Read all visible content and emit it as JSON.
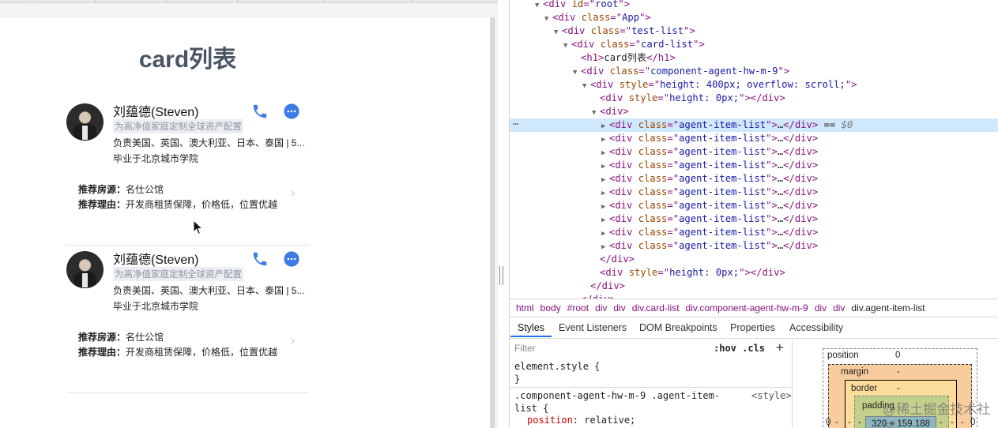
{
  "app": {
    "heading": "card列表",
    "cards": [
      {
        "name": "刘蕴德(Steven)",
        "tag": "为高净值家庭定制全球资产配置",
        "desc": "负责美国、英国、澳大利亚、日本、泰国 | 5...",
        "school": "毕业于北京城市学院",
        "rec_source_label": "推荐房源：",
        "rec_source": "名仕公馆",
        "rec_reason_label": "推荐理由：",
        "rec_reason": "开发商租赁保障，价格低，位置优越"
      },
      {
        "name": "刘蕴德(Steven)",
        "tag": "为高净值家庭定制全球资产配置",
        "desc": "负责美国、英国、澳大利亚、日本、泰国 | 5...",
        "school": "毕业于北京城市学院",
        "rec_source_label": "推荐房源：",
        "rec_source": "名仕公馆",
        "rec_reason_label": "推荐理由：",
        "rec_reason": "开发商租赁保障，价格低，位置优越"
      }
    ],
    "accent_color": "#3d7be6"
  },
  "devtools": {
    "dom_lines": [
      {
        "t": "▼",
        "parts": [
          [
            "tg",
            "<div "
          ],
          [
            "at",
            "id"
          ],
          [
            "tg",
            "=\""
          ],
          [
            "av",
            "root"
          ],
          [
            "tg",
            "\">"
          ]
        ]
      },
      {
        "t": "▼",
        "parts": [
          [
            "tg",
            "<div "
          ],
          [
            "at",
            "class"
          ],
          [
            "tg",
            "=\""
          ],
          [
            "av",
            "App"
          ],
          [
            "tg",
            "\">"
          ]
        ]
      },
      {
        "t": "▼",
        "parts": [
          [
            "tg",
            "<div "
          ],
          [
            "at",
            "class"
          ],
          [
            "tg",
            "=\""
          ],
          [
            "av",
            "test-list"
          ],
          [
            "tg",
            "\">"
          ]
        ]
      },
      {
        "t": "▼",
        "parts": [
          [
            "tg",
            "<div "
          ],
          [
            "at",
            "class"
          ],
          [
            "tg",
            "=\""
          ],
          [
            "av",
            "card-list"
          ],
          [
            "tg",
            "\">"
          ]
        ]
      },
      {
        "t": "",
        "parts": [
          [
            "tg",
            "<h1>"
          ],
          [
            "tx",
            "card列表"
          ],
          [
            "tg",
            "</h1>"
          ]
        ]
      },
      {
        "t": "▼",
        "parts": [
          [
            "tg",
            "<div "
          ],
          [
            "at",
            "class"
          ],
          [
            "tg",
            "=\""
          ],
          [
            "av",
            "component-agent-hw-m-9"
          ],
          [
            "tg",
            "\">"
          ]
        ]
      },
      {
        "t": "▼",
        "parts": [
          [
            "tg",
            "<div "
          ],
          [
            "at",
            "style"
          ],
          [
            "tg",
            "=\""
          ],
          [
            "av",
            "height: 400px; overflow: scroll;"
          ],
          [
            "tg",
            "\">"
          ]
        ]
      },
      {
        "t": "",
        "parts": [
          [
            "tg",
            "<div "
          ],
          [
            "at",
            "style"
          ],
          [
            "tg",
            "=\""
          ],
          [
            "av",
            "height: 0px;"
          ],
          [
            "tg",
            "\"></div>"
          ]
        ]
      },
      {
        "t": "▼",
        "parts": [
          [
            "tg",
            "<div>"
          ]
        ]
      },
      {
        "t": "▶",
        "parts": [
          [
            "tg",
            "<div "
          ],
          [
            "at",
            "class"
          ],
          [
            "tg",
            "=\""
          ],
          [
            "av",
            "agent-item-list"
          ],
          [
            "tg",
            "\">"
          ],
          [
            "tx",
            "…"
          ],
          [
            "tg",
            "</div>"
          ],
          [
            "tx",
            " == "
          ],
          [
            "dl",
            "$0"
          ]
        ]
      },
      {
        "t": "▶",
        "parts": [
          [
            "tg",
            "<div "
          ],
          [
            "at",
            "class"
          ],
          [
            "tg",
            "=\""
          ],
          [
            "av",
            "agent-item-list"
          ],
          [
            "tg",
            "\">"
          ],
          [
            "tx",
            "…"
          ],
          [
            "tg",
            "</div>"
          ]
        ]
      },
      {
        "t": "▶",
        "parts": [
          [
            "tg",
            "<div "
          ],
          [
            "at",
            "class"
          ],
          [
            "tg",
            "=\""
          ],
          [
            "av",
            "agent-item-list"
          ],
          [
            "tg",
            "\">"
          ],
          [
            "tx",
            "…"
          ],
          [
            "tg",
            "</div>"
          ]
        ]
      },
      {
        "t": "▶",
        "parts": [
          [
            "tg",
            "<div "
          ],
          [
            "at",
            "class"
          ],
          [
            "tg",
            "=\""
          ],
          [
            "av",
            "agent-item-list"
          ],
          [
            "tg",
            "\">"
          ],
          [
            "tx",
            "…"
          ],
          [
            "tg",
            "</div>"
          ]
        ]
      },
      {
        "t": "▶",
        "parts": [
          [
            "tg",
            "<div "
          ],
          [
            "at",
            "class"
          ],
          [
            "tg",
            "=\""
          ],
          [
            "av",
            "agent-item-list"
          ],
          [
            "tg",
            "\">"
          ],
          [
            "tx",
            "…"
          ],
          [
            "tg",
            "</div>"
          ]
        ]
      },
      {
        "t": "▶",
        "parts": [
          [
            "tg",
            "<div "
          ],
          [
            "at",
            "class"
          ],
          [
            "tg",
            "=\""
          ],
          [
            "av",
            "agent-item-list"
          ],
          [
            "tg",
            "\">"
          ],
          [
            "tx",
            "…"
          ],
          [
            "tg",
            "</div>"
          ]
        ]
      },
      {
        "t": "▶",
        "parts": [
          [
            "tg",
            "<div "
          ],
          [
            "at",
            "class"
          ],
          [
            "tg",
            "=\""
          ],
          [
            "av",
            "agent-item-list"
          ],
          [
            "tg",
            "\">"
          ],
          [
            "tx",
            "…"
          ],
          [
            "tg",
            "</div>"
          ]
        ]
      },
      {
        "t": "▶",
        "parts": [
          [
            "tg",
            "<div "
          ],
          [
            "at",
            "class"
          ],
          [
            "tg",
            "=\""
          ],
          [
            "av",
            "agent-item-list"
          ],
          [
            "tg",
            "\">"
          ],
          [
            "tx",
            "…"
          ],
          [
            "tg",
            "</div>"
          ]
        ]
      },
      {
        "t": "▶",
        "parts": [
          [
            "tg",
            "<div "
          ],
          [
            "at",
            "class"
          ],
          [
            "tg",
            "=\""
          ],
          [
            "av",
            "agent-item-list"
          ],
          [
            "tg",
            "\">"
          ],
          [
            "tx",
            "…"
          ],
          [
            "tg",
            "</div>"
          ]
        ]
      },
      {
        "t": "▶",
        "parts": [
          [
            "tg",
            "<div "
          ],
          [
            "at",
            "class"
          ],
          [
            "tg",
            "=\""
          ],
          [
            "av",
            "agent-item-list"
          ],
          [
            "tg",
            "\">"
          ],
          [
            "tx",
            "…"
          ],
          [
            "tg",
            "</div>"
          ]
        ]
      },
      {
        "t": "",
        "parts": [
          [
            "tg",
            "</div>"
          ]
        ]
      },
      {
        "t": "",
        "parts": [
          [
            "tg",
            "<div "
          ],
          [
            "at",
            "style"
          ],
          [
            "tg",
            "=\""
          ],
          [
            "av",
            "height: 0px;"
          ],
          [
            "tg",
            "\"></div>"
          ]
        ]
      },
      {
        "t": "",
        "parts": [
          [
            "tg",
            "</div>"
          ]
        ]
      },
      {
        "t": "",
        "parts": [
          [
            "tg",
            "</div>"
          ]
        ]
      }
    ],
    "breadcrumbs": [
      "html",
      "body",
      "#root",
      "div",
      "div",
      "div.card-list",
      "div.component-agent-hw-m-9",
      "div",
      "div",
      "div.agent-item-list"
    ],
    "panel_tabs": [
      "Styles",
      "Event Listeners",
      "DOM Breakpoints",
      "Properties",
      "Accessibility"
    ],
    "styles": {
      "filter_placeholder": "Filter",
      "hov_cls": ":hov .cls",
      "plus": "+",
      "element_style": "element.style {",
      "close_brace": "}",
      "selector_line1": ".component-agent-hw-m-9 .agent-item-",
      "selector_line2": "list {",
      "source": "<style>",
      "prop_name": "position",
      "prop_value": ": relative;"
    },
    "box_model": {
      "position_label": "position",
      "position_value": "0",
      "margin_label": "margin",
      "margin_value": "-",
      "border_label": "border",
      "border_value": "-",
      "padding_label": "padding",
      "content": "320 × 159.188",
      "left_value": "0",
      "right_value": "0",
      "dash": "-"
    },
    "watermark": "@稀土掘金技术社区"
  }
}
